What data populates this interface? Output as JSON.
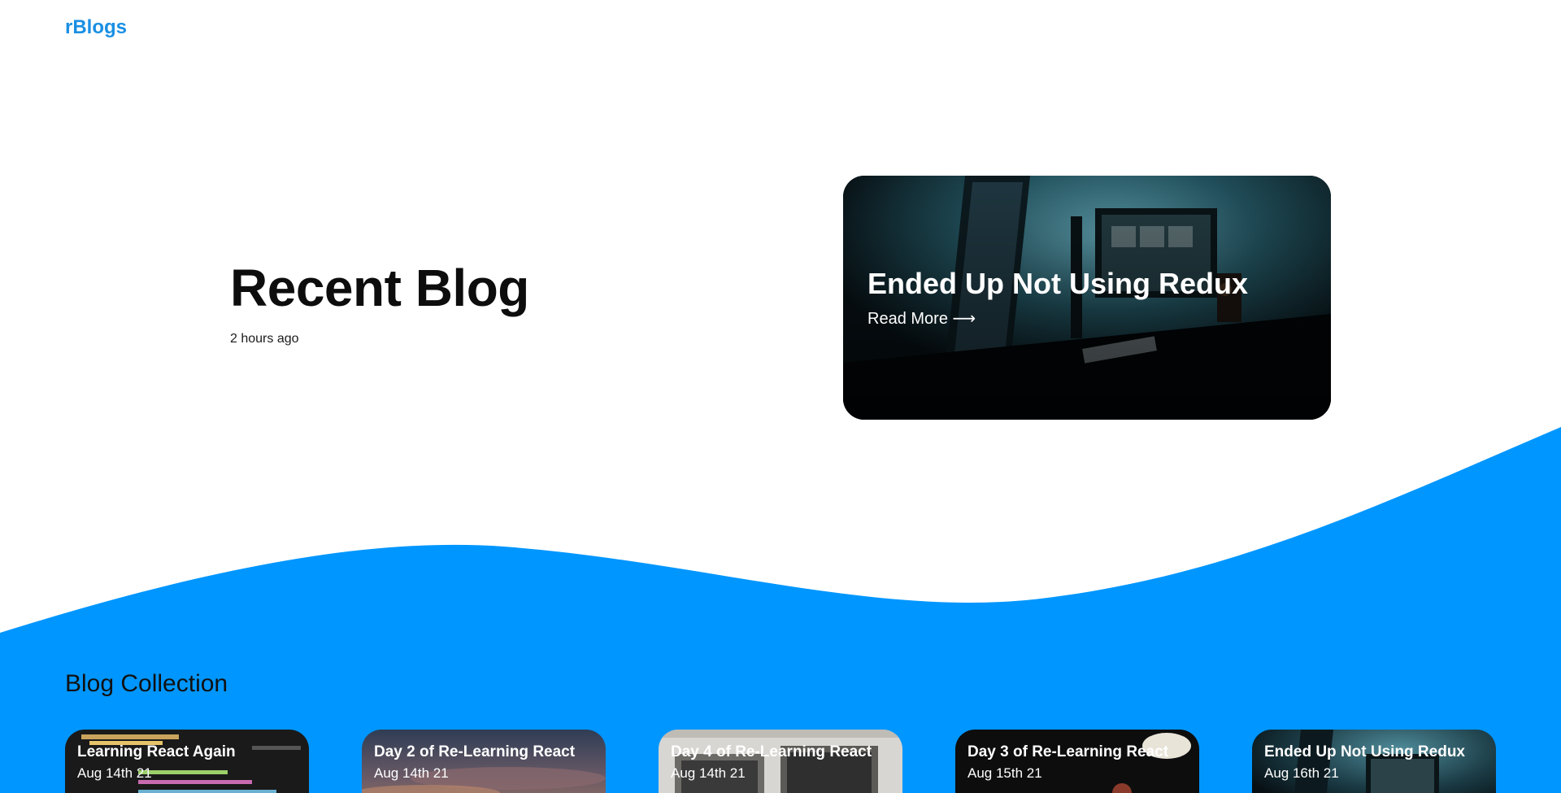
{
  "header": {
    "brand": "rBlogs"
  },
  "hero": {
    "title": "Recent Blog",
    "time_ago": "2 hours ago"
  },
  "featured": {
    "title": "Ended Up Not Using Redux",
    "read_more": "Read More ⟶"
  },
  "collection": {
    "title": "Blog Collection",
    "cards": [
      {
        "title": "Learning React Again",
        "date": "Aug 14th 21"
      },
      {
        "title": "Day 2 of Re-Learning React",
        "date": "Aug 14th 21"
      },
      {
        "title": "Day 4 of Re-Learning React",
        "date": "Aug 14th 21"
      },
      {
        "title": "Day 3 of Re-Learning React",
        "date": "Aug 15th 21"
      },
      {
        "title": "Ended Up Not Using Redux",
        "date": "Aug 16th 21"
      }
    ]
  },
  "colors": {
    "brand": "#1a8fe3",
    "wave": "#0096ff"
  }
}
